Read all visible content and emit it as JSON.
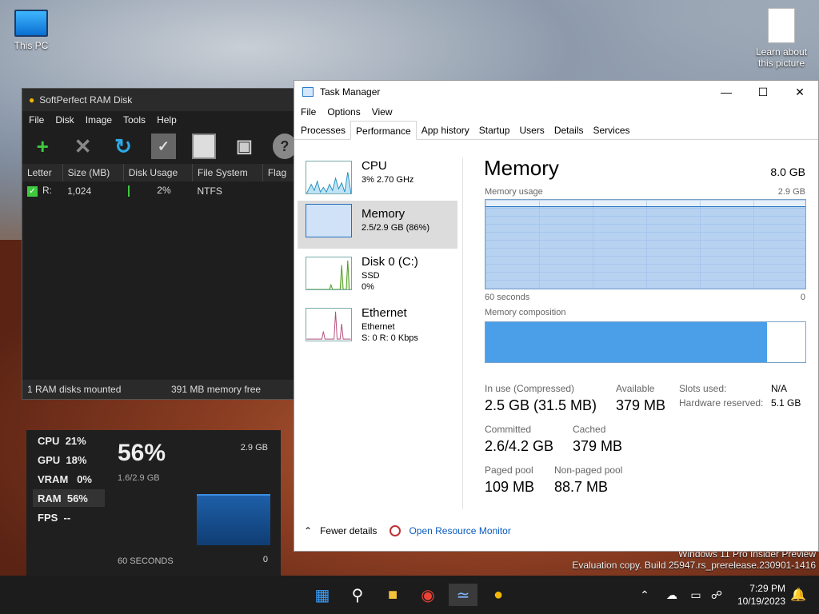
{
  "desktop": {
    "icons": [
      {
        "label": "This PC",
        "icon": "monitor-icon"
      },
      {
        "label": "Learn about this picture",
        "icon": "document-icon"
      }
    ],
    "watermark": {
      "line1": "Windows 11 Pro Insider Preview",
      "line2": "Evaluation copy. Build 25947.rs_prerelease.230901-1416"
    }
  },
  "ramdisk": {
    "title": "SoftPerfect RAM Disk",
    "menu": [
      "File",
      "Disk",
      "Image",
      "Tools",
      "Help"
    ],
    "toolbar": [
      "add-icon",
      "remove-icon",
      "refresh-icon",
      "checkmark-icon",
      "blank-icon",
      "save-icon",
      "help-icon"
    ],
    "columns": [
      "Letter",
      "Size (MB)",
      "Disk Usage",
      "File System",
      "Flag"
    ],
    "rows": [
      {
        "letter": "R:",
        "size": "1,024",
        "usage": "2%",
        "fs": "NTFS"
      }
    ],
    "status_left": "1 RAM disks mounted",
    "status_right": "391 MB memory free"
  },
  "overlay": {
    "rows": [
      {
        "label": "CPU",
        "value": "21%"
      },
      {
        "label": "GPU",
        "value": "18%"
      },
      {
        "label": "VRAM",
        "value": "0%"
      },
      {
        "label": "RAM",
        "value": "56%"
      },
      {
        "label": "FPS",
        "value": "--"
      }
    ],
    "big_value": "56%",
    "sub_value": "1.6/2.9 GB",
    "max_label": "2.9 GB",
    "seconds": "60 SECONDS",
    "zero": "0",
    "fill_level": 0.56
  },
  "taskmgr": {
    "title": "Task Manager",
    "menu": [
      "File",
      "Options",
      "View"
    ],
    "tabs": [
      "Processes",
      "Performance",
      "App history",
      "Startup",
      "Users",
      "Details",
      "Services"
    ],
    "active_tab": "Performance",
    "resources": [
      {
        "name": "CPU",
        "l1": "3%  2.70 GHz",
        "l2": ""
      },
      {
        "name": "Memory",
        "l1": "2.5/2.9 GB (86%)",
        "l2": ""
      },
      {
        "name": "Disk 0 (C:)",
        "l1": "SSD",
        "l2": "0%"
      },
      {
        "name": "Ethernet",
        "l1": "Ethernet",
        "l2": "S: 0  R: 0 Kbps"
      }
    ],
    "memory": {
      "title": "Memory",
      "total": "8.0 GB",
      "usage_label": "Memory usage",
      "usage_max": "2.9 GB",
      "graph_left": "60 seconds",
      "graph_right": "0",
      "comp_label": "Memory composition",
      "comp_used_fraction": 0.88,
      "in_use_label": "In use (Compressed)",
      "in_use": "2.5 GB (31.5 MB)",
      "available_label": "Available",
      "available": "379 MB",
      "committed_label": "Committed",
      "committed": "2.6/4.2 GB",
      "cached_label": "Cached",
      "cached": "379 MB",
      "paged_label": "Paged pool",
      "paged": "109 MB",
      "nonpaged_label": "Non-paged pool",
      "nonpaged": "88.7 MB",
      "slots_label": "Slots used:",
      "slots": "N/A",
      "hw_label": "Hardware reserved:",
      "hw": "5.1 GB"
    },
    "footer": {
      "fewer": "Fewer details",
      "monitor": "Open Resource Monitor"
    }
  },
  "taskbar": {
    "apps": [
      "windows-start-icon",
      "search-icon",
      "file-explorer-icon",
      "chrome-icon",
      "task-manager-icon",
      "ramdisk-icon"
    ],
    "time": "7:29 PM",
    "date": "10/19/2023"
  }
}
